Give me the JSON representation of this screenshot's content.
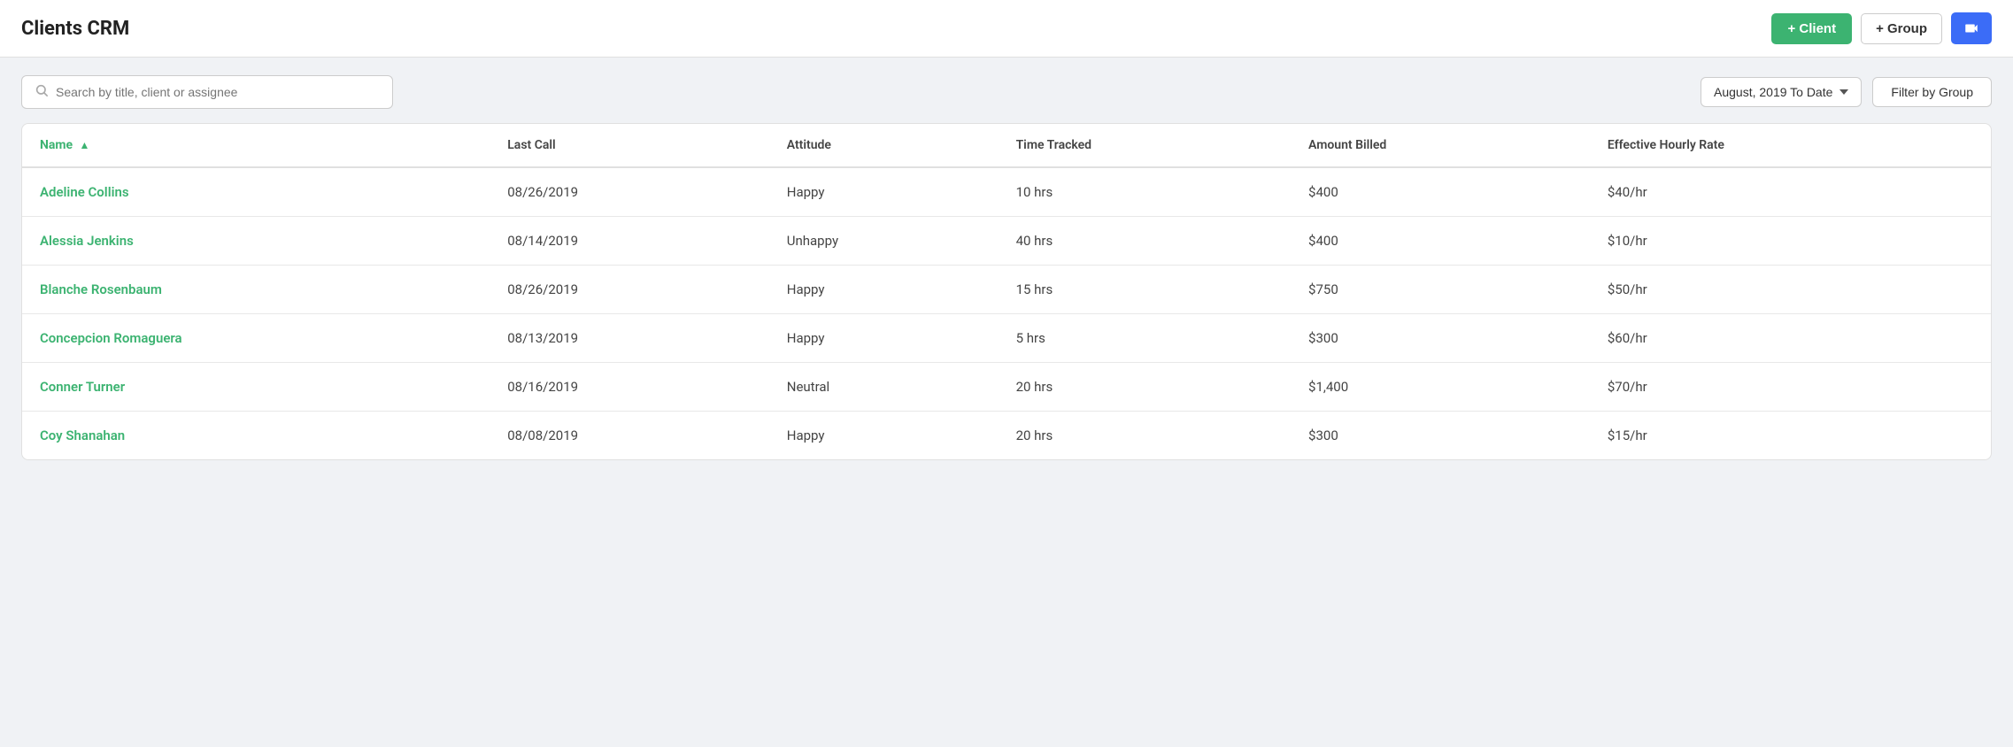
{
  "header": {
    "title": "Clients CRM",
    "btn_client_label": "+ Client",
    "btn_group_label": "+ Group",
    "btn_video_label": "📹"
  },
  "toolbar": {
    "search_placeholder": "Search by title, client or assignee",
    "date_filter_label": "August, 2019 To Date",
    "group_filter_label": "Filter by Group"
  },
  "table": {
    "columns": [
      {
        "key": "name",
        "label": "Name",
        "sorted": true
      },
      {
        "key": "last_call",
        "label": "Last Call"
      },
      {
        "key": "attitude",
        "label": "Attitude"
      },
      {
        "key": "time_tracked",
        "label": "Time Tracked"
      },
      {
        "key": "amount_billed",
        "label": "Amount Billed"
      },
      {
        "key": "effective_hourly_rate",
        "label": "Effective Hourly Rate"
      }
    ],
    "rows": [
      {
        "name": "Adeline Collins",
        "last_call": "08/26/2019",
        "attitude": "Happy",
        "time_tracked": "10 hrs",
        "amount_billed": "$400",
        "effective_hourly_rate": "$40/hr"
      },
      {
        "name": "Alessia Jenkins",
        "last_call": "08/14/2019",
        "attitude": "Unhappy",
        "time_tracked": "40 hrs",
        "amount_billed": "$400",
        "effective_hourly_rate": "$10/hr"
      },
      {
        "name": "Blanche Rosenbaum",
        "last_call": "08/26/2019",
        "attitude": "Happy",
        "time_tracked": "15 hrs",
        "amount_billed": "$750",
        "effective_hourly_rate": "$50/hr"
      },
      {
        "name": "Concepcion Romaguera",
        "last_call": "08/13/2019",
        "attitude": "Happy",
        "time_tracked": "5 hrs",
        "amount_billed": "$300",
        "effective_hourly_rate": "$60/hr"
      },
      {
        "name": "Conner Turner",
        "last_call": "08/16/2019",
        "attitude": "Neutral",
        "time_tracked": "20 hrs",
        "amount_billed": "$1,400",
        "effective_hourly_rate": "$70/hr"
      },
      {
        "name": "Coy Shanahan",
        "last_call": "08/08/2019",
        "attitude": "Happy",
        "time_tracked": "20 hrs",
        "amount_billed": "$300",
        "effective_hourly_rate": "$15/hr"
      }
    ]
  }
}
